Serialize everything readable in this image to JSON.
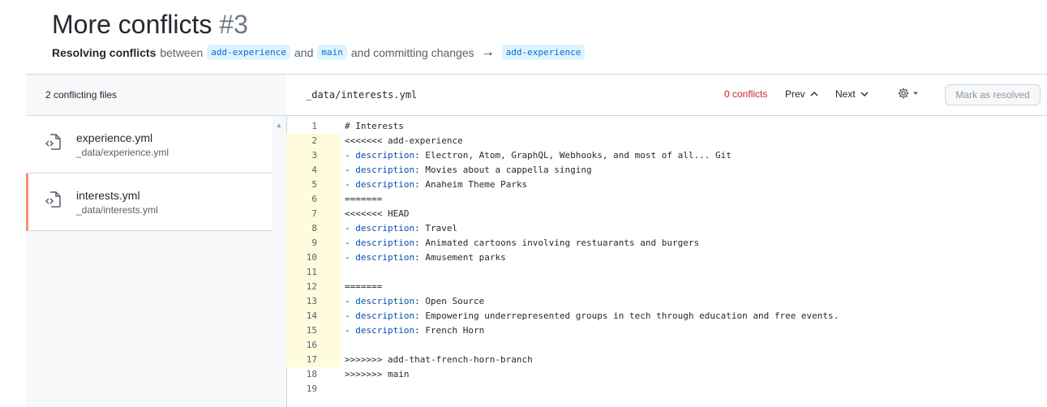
{
  "header": {
    "title": "More conflicts",
    "number": "#3",
    "subtitle_bold": "Resolving conflicts",
    "subtitle_between": "between",
    "branch_from": "add-experience",
    "subtitle_and": "and",
    "branch_to": "main",
    "subtitle_committing": "and committing changes",
    "arrow": "→",
    "branch_target": "add-experience"
  },
  "sidebar": {
    "heading": "2 conflicting files",
    "files": [
      {
        "name": "experience.yml",
        "path": "_data/experience.yml"
      },
      {
        "name": "interests.yml",
        "path": "_data/interests.yml"
      }
    ]
  },
  "toolbar": {
    "file_path": "_data/interests.yml",
    "conflicts": "0 conflicts",
    "prev": "Prev",
    "next": "Next",
    "mark_resolved": "Mark as resolved"
  },
  "code": [
    {
      "n": "1",
      "t": "# Interests"
    },
    {
      "n": "2",
      "t": "<<<<<<< add-experience"
    },
    {
      "n": "3",
      "k": "description",
      "t": "Electron, Atom, GraphQL, Webhooks, and most of all... Git"
    },
    {
      "n": "4",
      "k": "description",
      "t": "Movies about a cappella singing"
    },
    {
      "n": "5",
      "k": "description",
      "t": "Anaheim Theme Parks"
    },
    {
      "n": "6",
      "t": "======="
    },
    {
      "n": "7",
      "t": "<<<<<<< HEAD"
    },
    {
      "n": "8",
      "k": "description",
      "t": "Travel"
    },
    {
      "n": "9",
      "k": "description",
      "t": "Animated cartoons involving restuarants and burgers"
    },
    {
      "n": "10",
      "k": "description",
      "t": "Amusement parks"
    },
    {
      "n": "11",
      "t": ""
    },
    {
      "n": "12",
      "t": "======="
    },
    {
      "n": "13",
      "k": "description",
      "t": "Open Source"
    },
    {
      "n": "14",
      "k": "description",
      "t": "Empowering underrepresented groups in tech through education and free events."
    },
    {
      "n": "15",
      "k": "description",
      "t": "French Horn"
    },
    {
      "n": "16",
      "t": ""
    },
    {
      "n": "17",
      "t": ">>>>>>> add-that-french-horn-branch"
    },
    {
      "n": "18",
      "t": ">>>>>>> main"
    },
    {
      "n": "19",
      "t": ""
    }
  ],
  "colors": {
    "accent": "#0969da",
    "conflict": "#cf222e",
    "active_border": "#fd8c73",
    "marker_bg": "#fffbdd"
  }
}
